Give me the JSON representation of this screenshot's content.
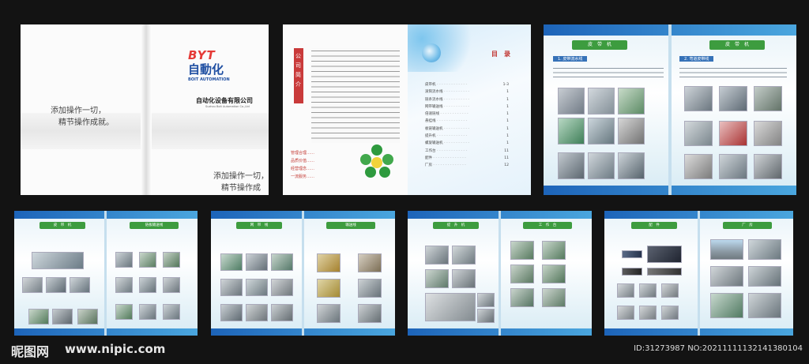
{
  "cover": {
    "logo_letters": "BYT",
    "logo_chinese": "自動化",
    "logo_english": "BOIT AUTOMATION",
    "company_name": "自动化设备有限公司",
    "company_english": "Suzhou Boit Automation Co.,Ltd",
    "slogan_line1": "添加操作一切，",
    "slogan_line2": "精节操作成就。"
  },
  "intro": {
    "title": "公司简介",
    "values": [
      "管理合理……",
      "品质价值……",
      "经营理念……",
      "一流服务……"
    ],
    "circles": [
      "团队精神",
      "团结协作",
      "自我提升",
      "追求卓越",
      "服务至上"
    ]
  },
  "toc": {
    "title": "目　录",
    "items": [
      "皮带机",
      "滚筒流水线",
      "链条流水线",
      "网带输送线",
      "倍速链线",
      "悬挂线",
      "板链输送机",
      "提升机",
      "螺旋输送机",
      "工作台",
      "配件",
      "厂房"
    ],
    "pages": [
      "1-3",
      "1",
      "1",
      "1",
      "1",
      "1",
      "1",
      "1",
      "1",
      "11",
      "11",
      "12"
    ]
  },
  "sections": {
    "belt": "皮　带　机",
    "belt_sub": "1. 皮带流水线",
    "belt_sub2": "2. 弯道皮带线",
    "chain": "皮　带　机",
    "roller": "链板输送线",
    "mesh": "网　带　线",
    "sort": "输送线",
    "lift": "提　升　机",
    "bench": "工　作　台",
    "parts": "配　件",
    "factory": "厂　房"
  },
  "watermark": {
    "site_logo": "昵图网",
    "site_url": "www.nipic.com",
    "id_text": "ID:31273987 NO:20211111132141380104"
  }
}
